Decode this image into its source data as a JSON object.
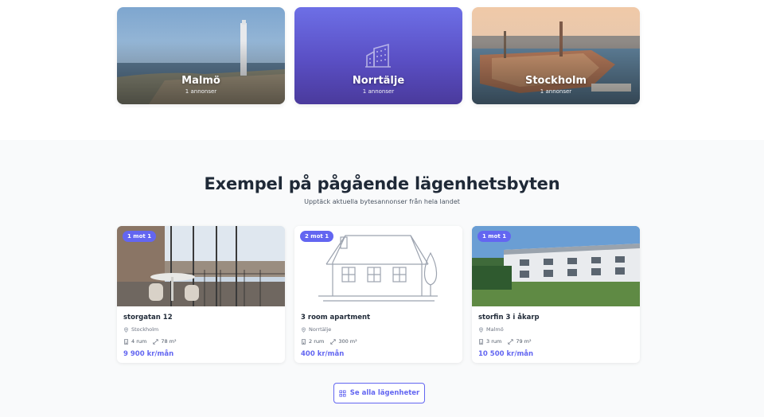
{
  "cities": [
    {
      "name": "Malmö",
      "count": "1 annonser"
    },
    {
      "name": "Norrtälje",
      "count": "1 annonser",
      "icon": "buildings-icon"
    },
    {
      "name": "Stockholm",
      "count": "1 annonser"
    }
  ],
  "section": {
    "title": "Exempel på pågående lägenhetsbyten",
    "subtitle": "Upptäck aktuella bytesannonser från hela landet"
  },
  "listings": [
    {
      "badge": "1 mot 1",
      "title": "storgatan 12",
      "location": "Stockholm",
      "rooms": "4 rum",
      "area": "78 m²",
      "price": "9 900 kr/mån"
    },
    {
      "badge": "2 mot 1",
      "title": "3 room apartment",
      "location": "Norrtälje",
      "rooms": "2 rum",
      "area": "300 m²",
      "price": "400 kr/mån"
    },
    {
      "badge": "1 mot 1",
      "title": "storfin 3 i åkarp",
      "location": "Malmö",
      "rooms": "3 rum",
      "area": "79 m²",
      "price": "10 500 kr/mån"
    }
  ],
  "see_all_label": "Se alla lägenheter",
  "colors": {
    "accent": "#6366f1",
    "section_bg": "#f9fafb"
  }
}
